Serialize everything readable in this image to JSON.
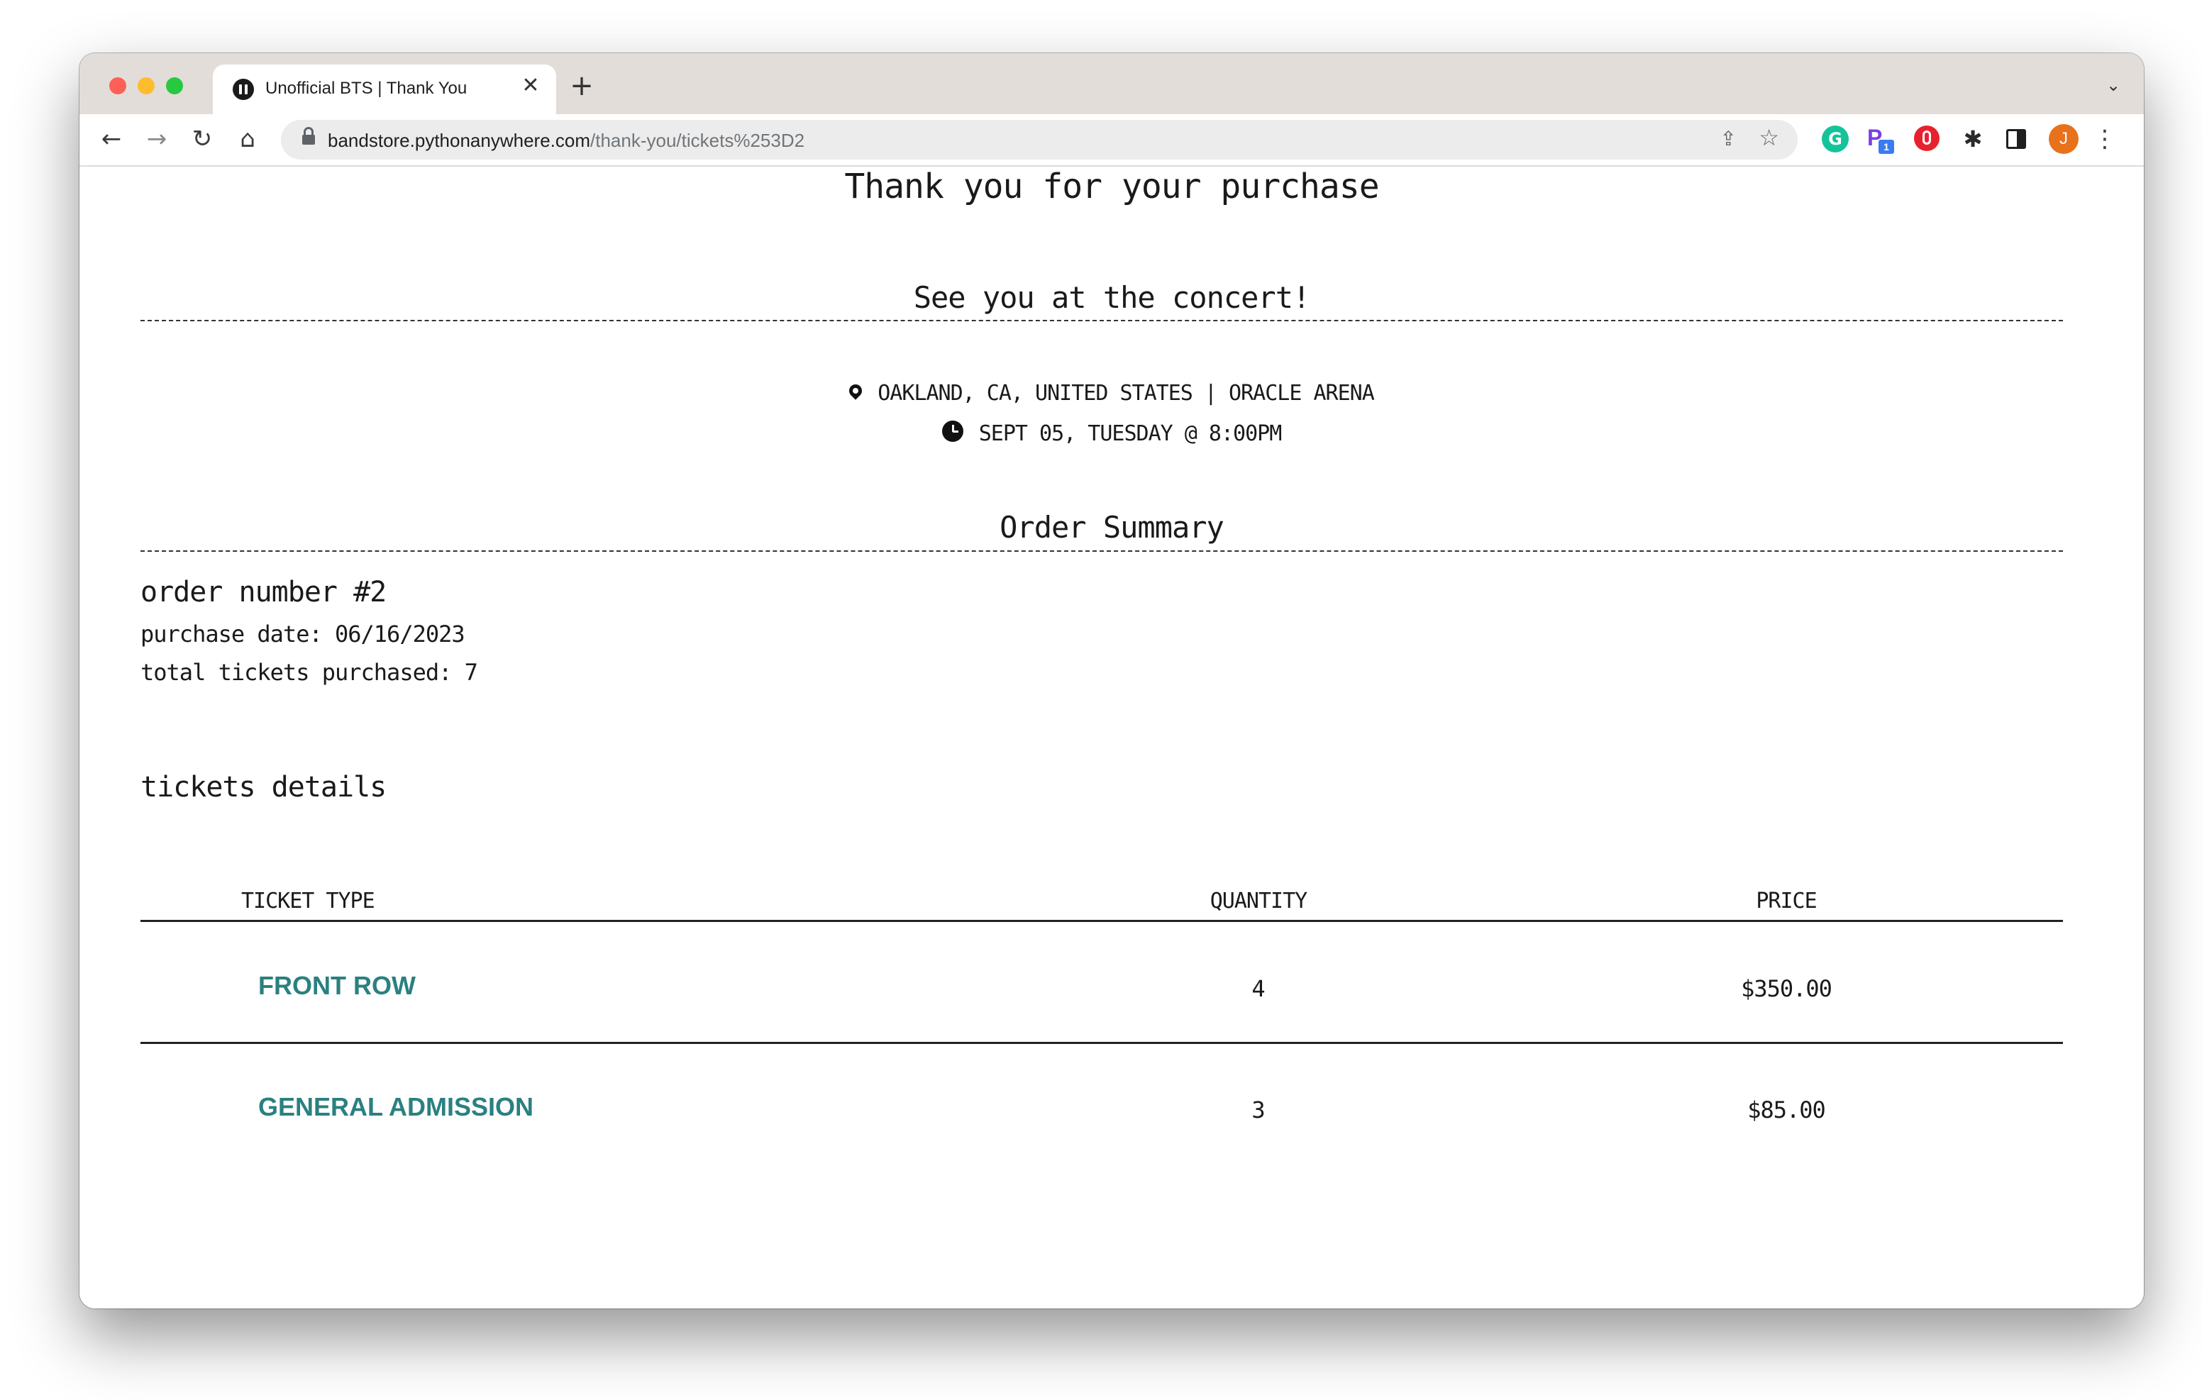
{
  "browser": {
    "tab_title": "Unofficial BTS | Thank You",
    "tab_close": "✕",
    "new_tab": "+",
    "url_host": "bandstore.pythonanywhere.com",
    "url_path": "/thank-you/tickets%253D2",
    "profile_initial": "J",
    "extension_badge": "1",
    "icons": [
      "back-icon",
      "forward-icon",
      "reload-icon",
      "home-icon",
      "lock-icon",
      "share-icon",
      "star-icon",
      "grammarly-icon",
      "p-extension-icon",
      "shield-extension-icon",
      "puzzle-icon",
      "side-panel-icon",
      "profile-avatar",
      "menu-icon"
    ]
  },
  "page": {
    "heading": "Thank you for your purchase",
    "subheading": "See you at the concert!",
    "location": "OAKLAND, CA, UNITED STATES | ORACLE ARENA",
    "datetime": "SEPT 05, TUESDAY @ 8:00PM",
    "summary_heading": "Order Summary",
    "order_number": "order number #2",
    "purchase_date": "purchase date: 06/16/2023",
    "total_tickets": "total tickets purchased: 7",
    "details_heading": "tickets details"
  },
  "table": {
    "headers": {
      "type": "TICKET TYPE",
      "quantity": "QUANTITY",
      "price": "PRICE"
    },
    "rows": [
      {
        "type": "FRONT ROW",
        "quantity": "4",
        "price": "$350.00"
      },
      {
        "type": "GENERAL ADMISSION",
        "quantity": "3",
        "price": "$85.00"
      }
    ]
  },
  "colors": {
    "ticket_type": "#2b8080",
    "tabstrip": "#e3ddd9"
  }
}
